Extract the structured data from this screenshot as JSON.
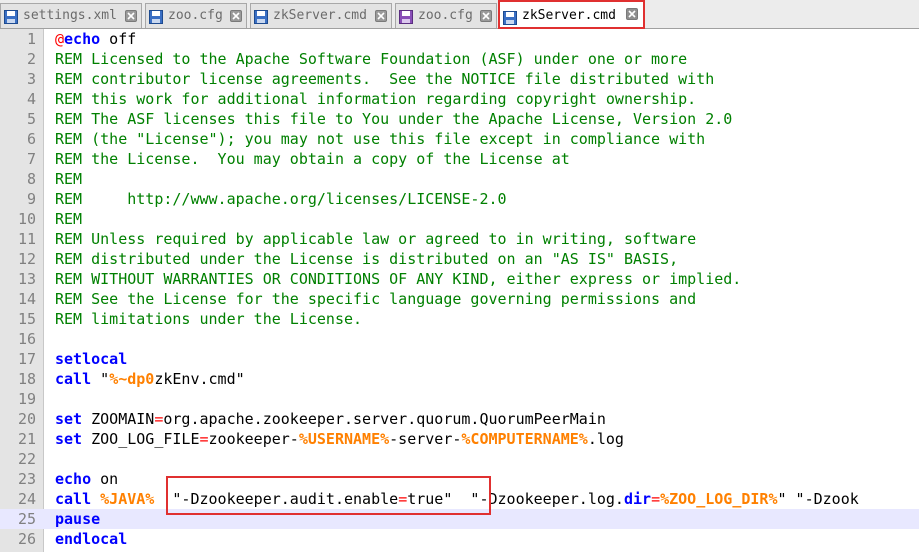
{
  "tabs": [
    {
      "label": "settings.xml",
      "icon": "floppy-disk-icon",
      "active": false
    },
    {
      "label": "zoo.cfg",
      "icon": "floppy-disk-icon",
      "active": false
    },
    {
      "label": "zkServer.cmd",
      "icon": "floppy-disk-icon",
      "active": false
    },
    {
      "label": "zoo.cfg",
      "icon": "floppy-disk-icon-modified",
      "active": false
    },
    {
      "label": "zkServer.cmd",
      "icon": "floppy-disk-icon",
      "active": true
    }
  ],
  "editor": {
    "current_line": 25,
    "lines": [
      {
        "n": "1",
        "t": [
          {
            "c": "at",
            "v": "@"
          },
          {
            "c": "kw",
            "v": "echo"
          },
          {
            "c": "plain",
            "v": " off"
          }
        ]
      },
      {
        "n": "2",
        "t": [
          {
            "c": "rem",
            "v": "REM Licensed to the Apache Software Foundation (ASF) under one or more"
          }
        ]
      },
      {
        "n": "3",
        "t": [
          {
            "c": "rem",
            "v": "REM contributor license agreements.  See the NOTICE file distributed with"
          }
        ]
      },
      {
        "n": "4",
        "t": [
          {
            "c": "rem",
            "v": "REM this work for additional information regarding copyright ownership."
          }
        ]
      },
      {
        "n": "5",
        "t": [
          {
            "c": "rem",
            "v": "REM The ASF licenses this file to You under the Apache License, Version 2.0"
          }
        ]
      },
      {
        "n": "6",
        "t": [
          {
            "c": "rem",
            "v": "REM (the \"License\"); you may not use this file except in compliance with"
          }
        ]
      },
      {
        "n": "7",
        "t": [
          {
            "c": "rem",
            "v": "REM the License.  You may obtain a copy of the License at"
          }
        ]
      },
      {
        "n": "8",
        "t": [
          {
            "c": "rem",
            "v": "REM"
          }
        ]
      },
      {
        "n": "9",
        "t": [
          {
            "c": "rem",
            "v": "REM     "
          },
          {
            "c": "rem url",
            "v": "http://www.apache.org/licenses/LICENSE-2.0"
          }
        ]
      },
      {
        "n": "10",
        "t": [
          {
            "c": "rem",
            "v": "REM"
          }
        ]
      },
      {
        "n": "11",
        "t": [
          {
            "c": "rem",
            "v": "REM Unless required by applicable law or agreed to in writing, software"
          }
        ]
      },
      {
        "n": "12",
        "t": [
          {
            "c": "rem",
            "v": "REM distributed under the License is distributed on an \"AS IS\" BASIS,"
          }
        ]
      },
      {
        "n": "13",
        "t": [
          {
            "c": "rem",
            "v": "REM WITHOUT WARRANTIES OR CONDITIONS OF ANY KIND, either express or implied."
          }
        ]
      },
      {
        "n": "14",
        "t": [
          {
            "c": "rem",
            "v": "REM See the License for the specific language governing permissions and"
          }
        ]
      },
      {
        "n": "15",
        "t": [
          {
            "c": "rem",
            "v": "REM limitations under the License."
          }
        ]
      },
      {
        "n": "16",
        "t": []
      },
      {
        "n": "17",
        "t": [
          {
            "c": "kw",
            "v": "setlocal"
          }
        ]
      },
      {
        "n": "18",
        "t": [
          {
            "c": "kw",
            "v": "call"
          },
          {
            "c": "plain",
            "v": " \""
          },
          {
            "c": "var",
            "v": "%~dp0"
          },
          {
            "c": "plain",
            "v": "zkEnv.cmd\""
          }
        ]
      },
      {
        "n": "19",
        "t": []
      },
      {
        "n": "20",
        "t": [
          {
            "c": "kw",
            "v": "set"
          },
          {
            "c": "plain",
            "v": " ZOOMAIN"
          },
          {
            "c": "op",
            "v": "="
          },
          {
            "c": "plain",
            "v": "org.apache.zookeeper.server.quorum.QuorumPeerMain"
          }
        ]
      },
      {
        "n": "21",
        "t": [
          {
            "c": "kw",
            "v": "set"
          },
          {
            "c": "plain",
            "v": " ZOO_LOG_FILE"
          },
          {
            "c": "op",
            "v": "="
          },
          {
            "c": "plain",
            "v": "zookeeper-"
          },
          {
            "c": "var",
            "v": "%USERNAME%"
          },
          {
            "c": "plain",
            "v": "-server-"
          },
          {
            "c": "var",
            "v": "%COMPUTERNAME%"
          },
          {
            "c": "plain",
            "v": ".log"
          }
        ]
      },
      {
        "n": "22",
        "t": []
      },
      {
        "n": "23",
        "t": [
          {
            "c": "kw",
            "v": "echo"
          },
          {
            "c": "plain",
            "v": " on"
          }
        ]
      },
      {
        "n": "24",
        "t": [
          {
            "c": "kw",
            "v": "call"
          },
          {
            "c": "plain",
            "v": " "
          },
          {
            "c": "var",
            "v": "%JAVA%"
          },
          {
            "c": "plain",
            "v": "  \"-Dzookeeper.audit.enable"
          },
          {
            "c": "op",
            "v": "="
          },
          {
            "c": "plain",
            "v": "true\"  \"-Dzookeeper.log."
          },
          {
            "c": "kw",
            "v": "dir"
          },
          {
            "c": "op",
            "v": "="
          },
          {
            "c": "var",
            "v": "%ZOO_LOG_DIR%"
          },
          {
            "c": "plain",
            "v": "\" \"-Dzook"
          }
        ]
      },
      {
        "n": "25",
        "t": [
          {
            "c": "kw",
            "v": "pause"
          }
        ]
      },
      {
        "n": "26",
        "t": [
          {
            "c": "kw",
            "v": "endlocal"
          }
        ]
      }
    ]
  }
}
